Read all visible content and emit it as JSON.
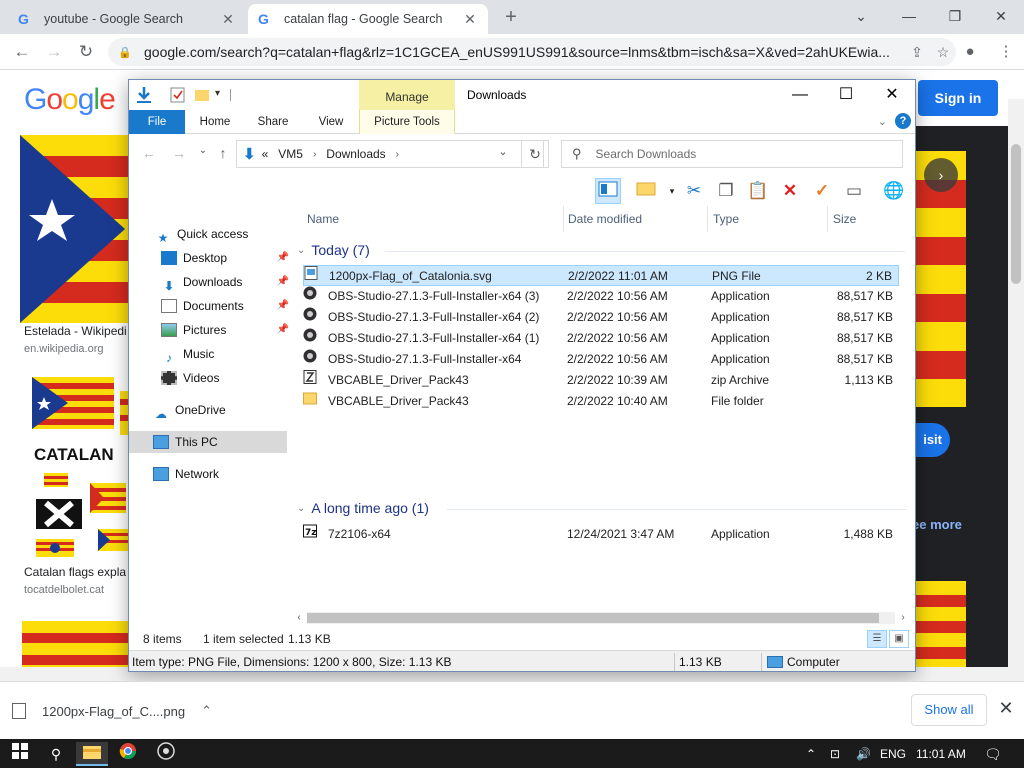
{
  "browser": {
    "tabs": [
      {
        "title": "youtube - Google Search",
        "favicon": "G",
        "active": false
      },
      {
        "title": "catalan flag - Google Search",
        "favicon": "G",
        "active": true
      }
    ],
    "new_tab_icon": "+",
    "url": "google.com/search?q=catalan+flag&rlz=1C1GCEA_enUS991US991&source=lnms&tbm=isch&sa=X&ved=2ahUKEwia...",
    "page": {
      "logo": "Google",
      "signin_label": "Sign in",
      "results": [
        {
          "caption": "Estelada - Wikipedi",
          "source": "en.wikipedia.org"
        },
        {
          "caption": "Catalan flags expla",
          "source": "tocatdelbolet.cat"
        }
      ],
      "catalan_text": "CATALAN",
      "visit_label": "isit",
      "see_more_label": "ee more",
      "next_icon": "›"
    },
    "downloads_shelf": {
      "item_label": "1200px-Flag_of_C....png",
      "show_all_label": "Show all",
      "close_icon": "✕"
    }
  },
  "explorer": {
    "title": "Downloads",
    "manage_label": "Manage",
    "ribbon_tabs": [
      "File",
      "Home",
      "Share",
      "View",
      "Picture Tools"
    ],
    "address": {
      "parts": [
        "«",
        "VM5",
        "Downloads"
      ]
    },
    "search_placeholder": "Search Downloads",
    "nav": {
      "quick_access": "Quick access",
      "items": [
        "Desktop",
        "Downloads",
        "Documents",
        "Pictures",
        "Music",
        "Videos"
      ],
      "onedrive": "OneDrive",
      "this_pc": "This PC",
      "network": "Network"
    },
    "columns": {
      "name": "Name",
      "date": "Date modified",
      "type": "Type",
      "size": "Size"
    },
    "groups": [
      {
        "label": "Today (7)",
        "files": [
          {
            "name": "1200px-Flag_of_Catalonia.svg",
            "date": "2/2/2022 11:01 AM",
            "type": "PNG File",
            "size": "2 KB",
            "selected": true,
            "icon": "image"
          },
          {
            "name": "OBS-Studio-27.1.3-Full-Installer-x64 (3)",
            "date": "2/2/2022 10:56 AM",
            "type": "Application",
            "size": "88,517 KB",
            "icon": "obs"
          },
          {
            "name": "OBS-Studio-27.1.3-Full-Installer-x64 (2)",
            "date": "2/2/2022 10:56 AM",
            "type": "Application",
            "size": "88,517 KB",
            "icon": "obs"
          },
          {
            "name": "OBS-Studio-27.1.3-Full-Installer-x64 (1)",
            "date": "2/2/2022 10:56 AM",
            "type": "Application",
            "size": "88,517 KB",
            "icon": "obs"
          },
          {
            "name": "OBS-Studio-27.1.3-Full-Installer-x64",
            "date": "2/2/2022 10:56 AM",
            "type": "Application",
            "size": "88,517 KB",
            "icon": "obs"
          },
          {
            "name": "VBCABLE_Driver_Pack43",
            "date": "2/2/2022 10:39 AM",
            "type": "zip Archive",
            "size": "1,113 KB",
            "icon": "zip"
          },
          {
            "name": "VBCABLE_Driver_Pack43",
            "date": "2/2/2022 10:40 AM",
            "type": "File folder",
            "size": "",
            "icon": "folder"
          }
        ]
      },
      {
        "label": "A long time ago (1)",
        "files": [
          {
            "name": "7z2106-x64",
            "date": "12/24/2021 3:47 AM",
            "type": "Application",
            "size": "1,488 KB",
            "icon": "7z"
          }
        ]
      }
    ],
    "status": {
      "count": "8 items",
      "selected": "1 item selected",
      "size": "1.13 KB"
    },
    "details_bar": {
      "item_info": "Item type: PNG File, Dimensions: 1200 x 800, Size: 1.13 KB",
      "size": "1.13 KB",
      "location": "Computer"
    }
  },
  "taskbar": {
    "language": "ENG",
    "time": "11:01 AM"
  },
  "colors": {
    "accent": "#1979ca",
    "google_blue": "#1a73e8",
    "catalan_red": "#d52b1e",
    "catalan_yellow": "#fcdd09",
    "estelada_blue": "#1a3a8f"
  }
}
